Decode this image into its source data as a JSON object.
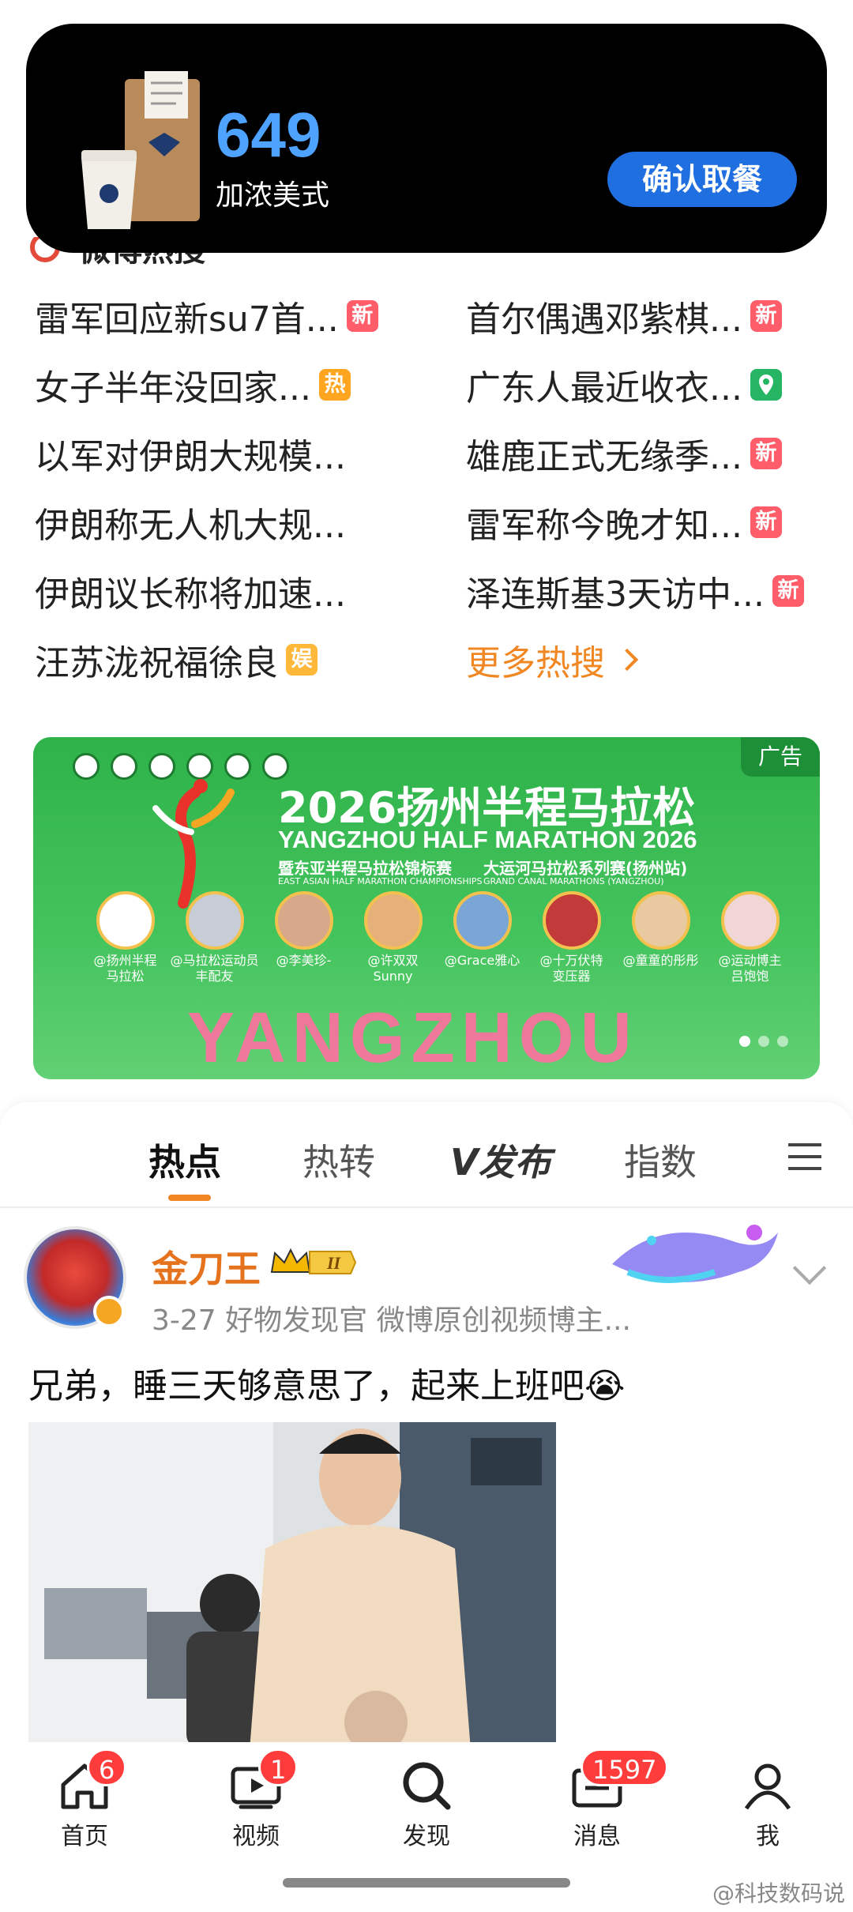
{
  "pickup": {
    "order_number": "649",
    "item": "加浓美式",
    "confirm_label": "确认取餐"
  },
  "hot_search": {
    "title": "微博热搜",
    "items": [
      {
        "text": "雷军回应新su7首...",
        "badge": "新",
        "badge_type": "new"
      },
      {
        "text": "首尔偶遇邓紫棋...",
        "badge": "新",
        "badge_type": "new"
      },
      {
        "text": "女子半年没回家...",
        "badge": "热",
        "badge_type": "hot"
      },
      {
        "text": "广东人最近收衣...",
        "badge": "location",
        "badge_type": "loc"
      },
      {
        "text": "以军对伊朗大规模...",
        "badge": "",
        "badge_type": ""
      },
      {
        "text": "雄鹿正式无缘季...",
        "badge": "新",
        "badge_type": "new"
      },
      {
        "text": "伊朗称无人机大规...",
        "badge": "",
        "badge_type": ""
      },
      {
        "text": "雷军称今晚才知...",
        "badge": "新",
        "badge_type": "new"
      },
      {
        "text": "伊朗议长称将加速...",
        "badge": "",
        "badge_type": ""
      },
      {
        "text": "泽连斯基3天访中...",
        "badge": "新",
        "badge_type": "new"
      },
      {
        "text": "汪苏泷祝福徐良",
        "badge": "娱",
        "badge_type": "ent"
      }
    ],
    "more_label": "更多热搜"
  },
  "ad": {
    "tag": "广告",
    "title": "2026扬州半程马拉松",
    "subtitle": "YANGZHOU HALF MARATHON 2026",
    "line_left": "暨东亚半程马拉松锦标赛",
    "line_left_en": "EAST ASIAN HALF MARATHON CHAMPIONSHIPS",
    "line_right": "大运河马拉松系列赛(扬州站)",
    "line_right_en": "GRAND CANAL MARATHONS (YANGZHOU)",
    "people": [
      {
        "name": "@扬州半程\n马拉松",
        "color": "#ffffff"
      },
      {
        "name": "@马拉松运动员\n丰配友",
        "color": "#c7ccd6"
      },
      {
        "name": "@李美珍-",
        "color": "#d8a88a"
      },
      {
        "name": "@许双双\nSunny",
        "color": "#e6b07a"
      },
      {
        "name": "@Grace雅心",
        "color": "#7aa6d6"
      },
      {
        "name": "@十万伏特\n变压器",
        "color": "#c23a3a"
      },
      {
        "name": "@童童的彤彤",
        "color": "#e8c9a0"
      },
      {
        "name": "@运动博主\n吕饱饱",
        "color": "#f0d6d6"
      }
    ],
    "banner_word": "YANGZHOU"
  },
  "tabs": [
    {
      "label": "热点",
      "active": true
    },
    {
      "label": "热转",
      "active": false
    },
    {
      "label": "V发布",
      "active": false
    },
    {
      "label": "指数",
      "active": false
    }
  ],
  "post": {
    "author": "金刀王",
    "level": "II",
    "meta": "3-27  好物发现官 微博原创视频博主...",
    "text": "兄弟，睡三天够意思了，起来上班吧😭"
  },
  "bottom_nav": [
    {
      "label": "首页",
      "icon": "home-icon",
      "count": "6"
    },
    {
      "label": "视频",
      "icon": "video-icon",
      "count": "1"
    },
    {
      "label": "发现",
      "icon": "discover-icon",
      "count": ""
    },
    {
      "label": "消息",
      "icon": "message-icon",
      "count": "1597"
    },
    {
      "label": "我",
      "icon": "profile-icon",
      "count": ""
    }
  ],
  "watermark": "@科技数码说"
}
